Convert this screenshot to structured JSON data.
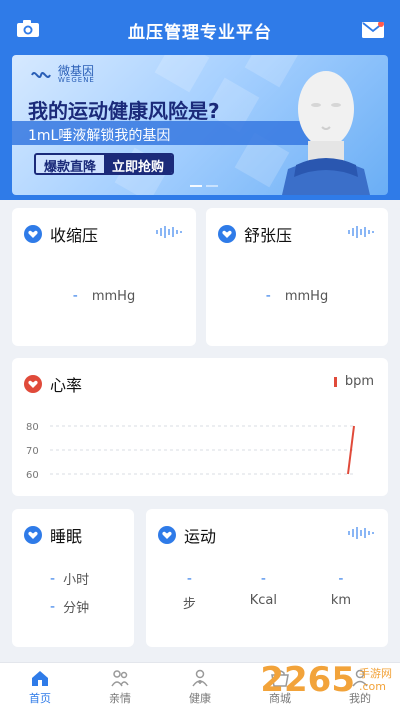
{
  "header": {
    "title": "血压管理专业平台",
    "left_icon": "camera-icon",
    "right_icon": "mail-icon",
    "bg_color": "#2f7be8"
  },
  "banner": {
    "brand_cn": "微基因",
    "brand_en": "WEGENE",
    "title": "我的运动健康风险是?",
    "subtitle": "1mL唾液解锁我的基因",
    "cta_left": "爆款直降",
    "cta_right": "立即抢购"
  },
  "systolic": {
    "title": "收缩压",
    "value": "-",
    "unit": "mmHg"
  },
  "diastolic": {
    "title": "舒张压",
    "value": "-",
    "unit": "mmHg"
  },
  "heart_rate": {
    "title": "心率",
    "legend_value": "-",
    "legend_unit": "bpm",
    "line_color": "#e04a3a"
  },
  "chart_data": {
    "type": "line",
    "title": "",
    "xlabel": "",
    "ylabel": "",
    "ylim": [
      60,
      80
    ],
    "y_ticks": [
      "80",
      "70",
      "60"
    ],
    "series": [
      {
        "values": [
          60,
          80
        ]
      }
    ]
  },
  "sleep": {
    "title": "睡眠",
    "hours_value": "-",
    "hours_unit": "小时",
    "minutes_value": "-",
    "minutes_unit": "分钟"
  },
  "sport": {
    "title": "运动",
    "steps_value": "-",
    "steps_unit": "步",
    "kcal_value": "-",
    "kcal_unit": "Kcal",
    "km_value": "-",
    "km_unit": "km"
  },
  "tabbar": {
    "items": [
      {
        "label": "首页",
        "icon": "home-icon"
      },
      {
        "label": "亲情",
        "icon": "family-icon"
      },
      {
        "label": "健康",
        "icon": "health-icon"
      },
      {
        "label": "商城",
        "icon": "shop-icon"
      },
      {
        "label": "我的",
        "icon": "profile-icon"
      }
    ]
  },
  "watermark": {
    "number": "2265",
    "suffix_top": "手游网",
    "suffix_bottom": ".com"
  }
}
